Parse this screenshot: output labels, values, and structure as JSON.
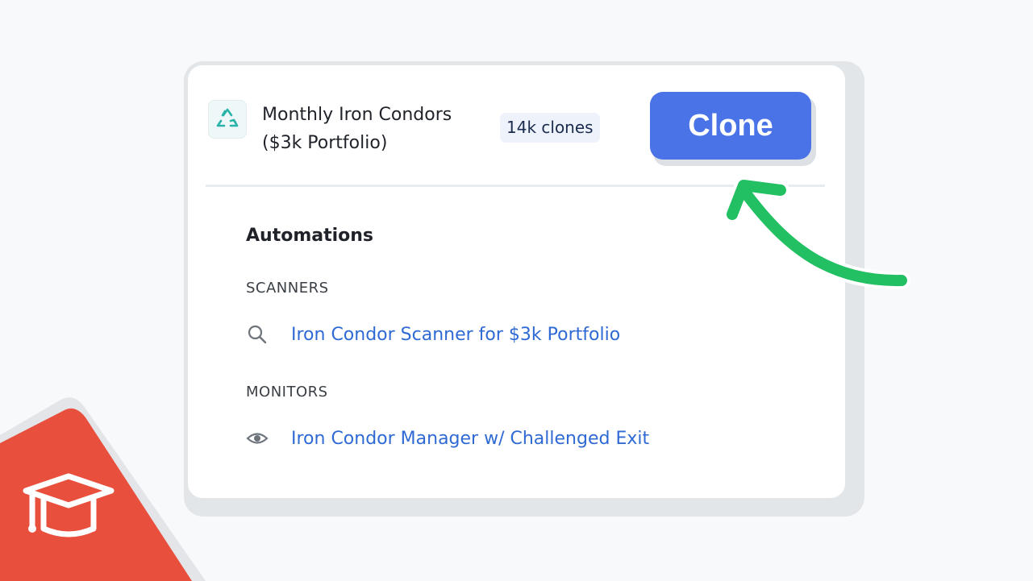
{
  "strategy": {
    "title_line1": "Monthly Iron Condors",
    "title_line2": "($3k Portfolio)",
    "clones": "14k clones",
    "icon": "recycle-icon"
  },
  "actions": {
    "clone_label": "Clone"
  },
  "automations": {
    "heading": "Automations",
    "scanners_label": "SCANNERS",
    "scanners": [
      {
        "label": "Iron Condor Scanner for $3k Portfolio",
        "icon": "search-icon"
      }
    ],
    "monitors_label": "MONITORS",
    "monitors": [
      {
        "label": "Iron Condor Manager w/ Challenged Exit",
        "icon": "eye-icon"
      }
    ]
  },
  "decor": {
    "arrow": "green-arrow-icon",
    "badge": "graduation-cap-icon"
  },
  "colors": {
    "accent": "#4a73e8",
    "arrow": "#22c063",
    "badge": "#e94f3d",
    "link": "#2f6ad4"
  }
}
